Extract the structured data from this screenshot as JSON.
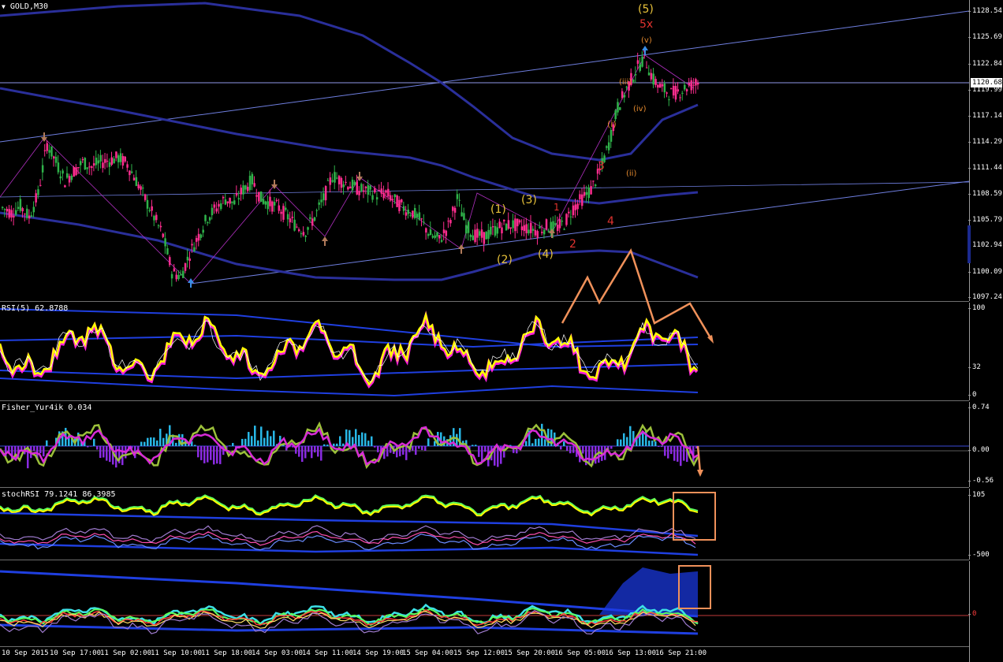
{
  "main_pane": {
    "label": "GOLD,M30",
    "price_axis": [
      "1128.54",
      "1125.69",
      "1122.84",
      "1119.99",
      "1117.14",
      "1114.29",
      "1111.44",
      "1108.59",
      "1105.79",
      "1102.94",
      "1100.09",
      "1097.24"
    ],
    "current_price": "1120.68",
    "wave_labels": {
      "top_5": "(5)",
      "top_5x": "5x",
      "v": "(v)",
      "iii": "(iii)",
      "iv": "(iv)",
      "i": "(i)",
      "ii": "(ii)",
      "n3_red": "3",
      "n4_red": "4",
      "n1_red": "1",
      "n2_red": "2",
      "w1": "(1)",
      "w2": "(2)",
      "w3": "(3)",
      "w4": "(4)"
    }
  },
  "rsi_pane": {
    "label": "RSI(5) 62.8788",
    "axis": [
      "100",
      "32",
      "0"
    ]
  },
  "fisher_pane": {
    "label": "Fisher_Yur4ik 0.034",
    "axis": [
      "0.74",
      "0.00",
      "-0.56"
    ]
  },
  "stochrsi_pane": {
    "label": "stochRSI 79.1241 86.3985",
    "axis": [
      "105",
      "-500"
    ]
  },
  "bottom_pane": {
    "axis": [
      "0"
    ]
  },
  "time_axis": [
    "10 Sep 2015",
    "10 Sep 17:00",
    "11 Sep 02:00",
    "11 Sep 10:00",
    "11 Sep 18:00",
    "14 Sep 03:00",
    "14 Sep 11:00",
    "14 Sep 19:00",
    "15 Sep 04:00",
    "15 Sep 12:00",
    "15 Sep 20:00",
    "16 Sep 05:00",
    "16 Sep 13:00",
    "16 Sep 21:00"
  ],
  "colors": {
    "bull": "#2fb34a",
    "bear": "#ff2d8f",
    "band": "#2a2f9a",
    "trend": "#6f7fe0",
    "orange": "#f0915a",
    "rsi": "#ffff00",
    "fisher_hist": "#28b7e6",
    "fisher_neg": "#8a2be2",
    "fisher_line": "#d72bd6"
  },
  "chart_data": {
    "type": "candlestick",
    "symbol": "GOLD",
    "timeframe": "M30",
    "ylim": [
      1097.24,
      1129.5
    ],
    "close_series": [
      1107,
      1106.5,
      1107.2,
      1106,
      1108.5,
      1114,
      1112,
      1110,
      1111,
      1112,
      1111.5,
      1112,
      1112.2,
      1112.5,
      1111.8,
      1110,
      1108,
      1106,
      1104,
      1100,
      1099.5,
      1102,
      1104,
      1106,
      1107,
      1108,
      1107.5,
      1109,
      1110,
      1108,
      1107.5,
      1107,
      1106,
      1105,
      1104.5,
      1106,
      1108,
      1110.5,
      1110,
      1109.5,
      1109,
      1108.8,
      1108.5,
      1108.6,
      1107.8,
      1107,
      1106.5,
      1105.5,
      1104,
      1103.5,
      1105,
      1108,
      1105,
      1104,
      1103.8,
      1104.5,
      1105,
      1105.2,
      1105,
      1104.8,
      1104.5,
      1105,
      1104.8,
      1105.3,
      1107,
      1108,
      1109,
      1111,
      1114,
      1118,
      1120,
      1122,
      1123.5,
      1121,
      1120,
      1119.5,
      1119.8,
      1120.4,
      1120.68
    ]
  }
}
